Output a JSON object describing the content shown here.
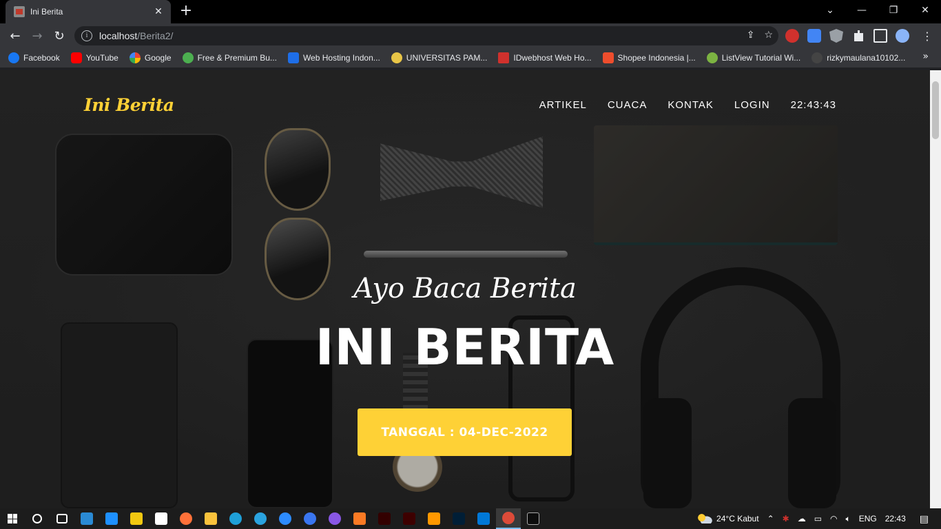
{
  "browser": {
    "tab_title": "Ini Berita",
    "tab_close": "✕",
    "new_tab": "+",
    "url_host": "localhost",
    "url_path": "/Berita2/",
    "window_controls": [
      "⌄",
      "—",
      "❐",
      "✕"
    ]
  },
  "bookmarks": [
    {
      "label": "Facebook",
      "color": "#1877f2"
    },
    {
      "label": "YouTube",
      "color": "#ff0000"
    },
    {
      "label": "Google",
      "color": "#ffffff"
    },
    {
      "label": "Free & Premium Bu...",
      "color": "#4caf50"
    },
    {
      "label": "Web Hosting Indon...",
      "color": "#1e6ee8"
    },
    {
      "label": "UNIVERSITAS PAM...",
      "color": "#e8c547"
    },
    {
      "label": "IDwebhost Web Ho...",
      "color": "#d0312d"
    },
    {
      "label": "Shopee Indonesia |...",
      "color": "#ee4d2d"
    },
    {
      "label": "ListView Tutorial Wi...",
      "color": "#7cb342"
    },
    {
      "label": "rizkymaulana10102...",
      "color": "#444444"
    }
  ],
  "site": {
    "brand": "Ini Berita",
    "nav": [
      "ARTIKEL",
      "CUACA",
      "KONTAK",
      "LOGIN"
    ],
    "clock": "22:43:43",
    "hero_subtitle": "Ayo Baca Berita",
    "hero_title": "INI BERITA",
    "hero_button": "TANGGAL : 04-DEC-2022",
    "accent_color": "#fed136"
  },
  "taskbar": {
    "apps": [
      {
        "name": "search",
        "color": "#ffffff"
      },
      {
        "name": "task-view",
        "color": "#ffffff"
      },
      {
        "name": "mail",
        "color": "#2a8ad4"
      },
      {
        "name": "store",
        "color": "#1e90ff"
      },
      {
        "name": "photos",
        "color": "#f2c811"
      },
      {
        "name": "security",
        "color": "#ffffff"
      },
      {
        "name": "firefox",
        "color": "#ff7139"
      },
      {
        "name": "file-explorer",
        "color": "#f9c23c"
      },
      {
        "name": "edge",
        "color": "#1fa0d8"
      },
      {
        "name": "telegram",
        "color": "#2aa3df"
      },
      {
        "name": "zoom",
        "color": "#2d8cff"
      },
      {
        "name": "signal",
        "color": "#3a76f0"
      },
      {
        "name": "github-desktop",
        "color": "#8957e5"
      },
      {
        "name": "xampp",
        "color": "#fb7a24"
      },
      {
        "name": "illustrator",
        "color": "#330000"
      },
      {
        "name": "flash",
        "color": "#3d0000"
      },
      {
        "name": "sublime-text",
        "color": "#ff9800"
      },
      {
        "name": "photoshop",
        "color": "#001e36"
      },
      {
        "name": "vscode",
        "color": "#0078d7"
      },
      {
        "name": "chrome",
        "color": "#dd4b39"
      },
      {
        "name": "terminal",
        "color": "#0c0c0c"
      }
    ],
    "weather": "24°C  Kabut",
    "lang": "ENG",
    "time": "22:43"
  }
}
